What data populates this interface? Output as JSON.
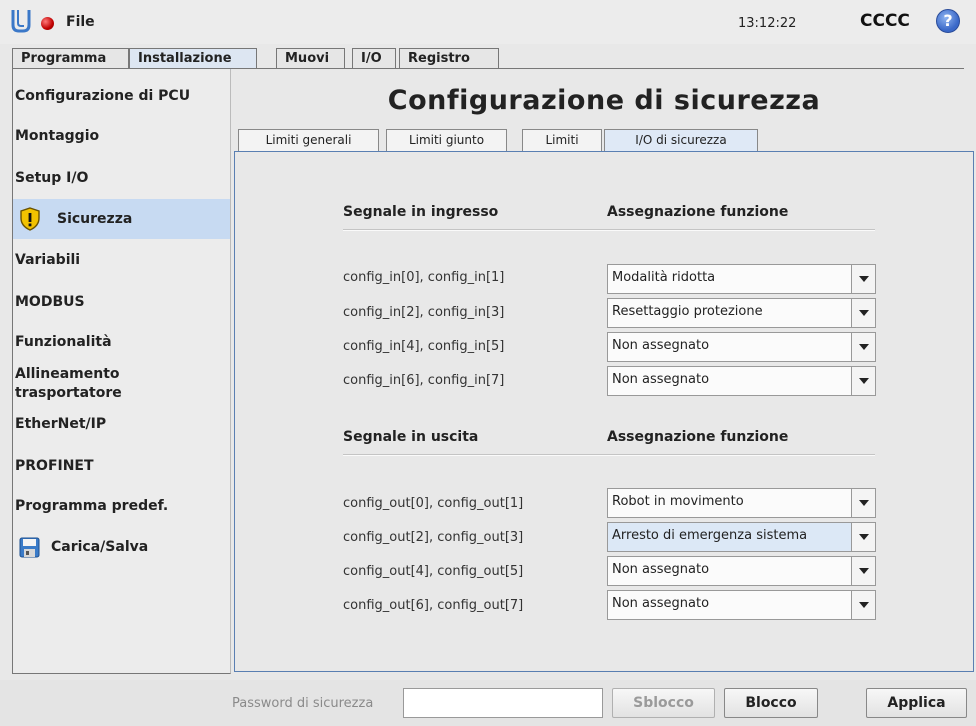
{
  "app": {
    "file_menu": "File",
    "clock": "13:12:22",
    "robot_name": "CCCC",
    "help_symbol": "?"
  },
  "main_tabs": [
    {
      "label": "Programma"
    },
    {
      "label": "Installazione",
      "active": true
    },
    {
      "label": "Muovi"
    },
    {
      "label": "I/O"
    },
    {
      "label": "Registro"
    }
  ],
  "sidebar": {
    "items": [
      {
        "label": "Configurazione di PCU"
      },
      {
        "label": "Montaggio"
      },
      {
        "label": "Setup I/O"
      },
      {
        "label": "Sicurezza",
        "icon": "shield-warning-icon",
        "active": true
      },
      {
        "label": "Variabili"
      },
      {
        "label": "MODBUS"
      },
      {
        "label": "Funzionalità"
      },
      {
        "label": "Allineamento trasportatore"
      },
      {
        "label": "EtherNet/IP"
      },
      {
        "label": "PROFINET"
      },
      {
        "label": "Programma predef."
      },
      {
        "label": "Carica/Salva",
        "icon": "floppy-disk-icon"
      }
    ]
  },
  "page": {
    "title": "Configurazione di sicurezza",
    "tabs": [
      {
        "label": "Limiti generali"
      },
      {
        "label": "Limiti giunto"
      },
      {
        "label": "Limiti"
      },
      {
        "label": "I/O di sicurezza",
        "active": true
      }
    ]
  },
  "inputs": {
    "signal_header": "Segnale in ingresso",
    "function_header": "Assegnazione funzione",
    "rows": [
      {
        "label": "config_in[0], config_in[1]",
        "value": "Modalità ridotta"
      },
      {
        "label": "config_in[2], config_in[3]",
        "value": "Resettaggio protezione"
      },
      {
        "label": "config_in[4], config_in[5]",
        "value": "Non assegnato"
      },
      {
        "label": "config_in[6], config_in[7]",
        "value": "Non assegnato"
      }
    ]
  },
  "outputs": {
    "signal_header": "Segnale in uscita",
    "function_header": "Assegnazione funzione",
    "rows": [
      {
        "label": "config_out[0], config_out[1]",
        "value": "Robot in movimento"
      },
      {
        "label": "config_out[2], config_out[3]",
        "value": "Arresto di emergenza sistema"
      },
      {
        "label": "config_out[4], config_out[5]",
        "value": "Non assegnato"
      },
      {
        "label": "config_out[6], config_out[7]",
        "value": "Non assegnato"
      }
    ]
  },
  "footer": {
    "password_label": "Password di sicurezza",
    "password_value": "",
    "unlock_label": "Sblocco",
    "lock_label": "Blocco",
    "apply_label": "Applica"
  }
}
